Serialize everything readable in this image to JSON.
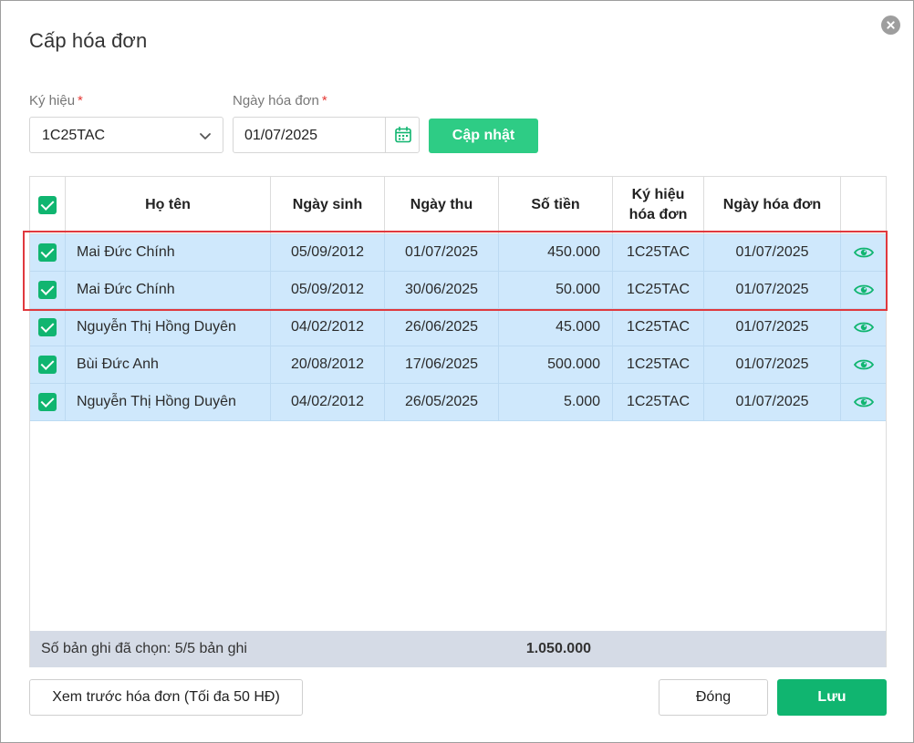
{
  "dialog": {
    "title": "Cấp hóa đơn",
    "close_icon": "close-icon"
  },
  "form": {
    "symbol_label": "Ký hiệu",
    "symbol_value": "1C25TAC",
    "date_label": "Ngày hóa đơn",
    "date_value": "01/07/2025",
    "required_mark": "*",
    "update_button": "Cập nhật"
  },
  "table": {
    "headers": {
      "name": "Họ tên",
      "dob": "Ngày sinh",
      "paid_date": "Ngày thu",
      "amount": "Số tiền",
      "symbol_line1": "Ký hiệu",
      "symbol_line2": "hóa đơn",
      "invoice_date": "Ngày hóa đơn"
    },
    "rows": [
      {
        "name": "Mai Đức Chính",
        "dob": "05/09/2012",
        "paid_date": "01/07/2025",
        "amount": "450.000",
        "symbol": "1C25TAC",
        "invoice_date": "01/07/2025",
        "checked": true
      },
      {
        "name": "Mai Đức Chính",
        "dob": "05/09/2012",
        "paid_date": "30/06/2025",
        "amount": "50.000",
        "symbol": "1C25TAC",
        "invoice_date": "01/07/2025",
        "checked": true
      },
      {
        "name": "Nguyễn Thị Hồng Duyên",
        "dob": "04/02/2012",
        "paid_date": "26/06/2025",
        "amount": "45.000",
        "symbol": "1C25TAC",
        "invoice_date": "01/07/2025",
        "checked": true
      },
      {
        "name": "Bùi Đức Anh",
        "dob": "20/08/2012",
        "paid_date": "17/06/2025",
        "amount": "500.000",
        "symbol": "1C25TAC",
        "invoice_date": "01/07/2025",
        "checked": true
      },
      {
        "name": "Nguyễn Thị Hồng Duyên",
        "dob": "04/02/2012",
        "paid_date": "26/05/2025",
        "amount": "5.000",
        "symbol": "1C25TAC",
        "invoice_date": "01/07/2025",
        "checked": true
      }
    ],
    "footer": {
      "selected_count": "Số bản ghi đã chọn: 5/5 bản ghi",
      "total": "1.050.000"
    }
  },
  "actions": {
    "preview": "Xem trước hóa đơn (Tối đa 50 HĐ)",
    "close": "Đóng",
    "save": "Lưu"
  },
  "colors": {
    "accent_green": "#10b570",
    "update_button_green": "#2ecc85",
    "row_selected_bg": "#cfe8fc",
    "highlight_border": "#e0393e",
    "footer_bg": "#d5dbe6"
  }
}
